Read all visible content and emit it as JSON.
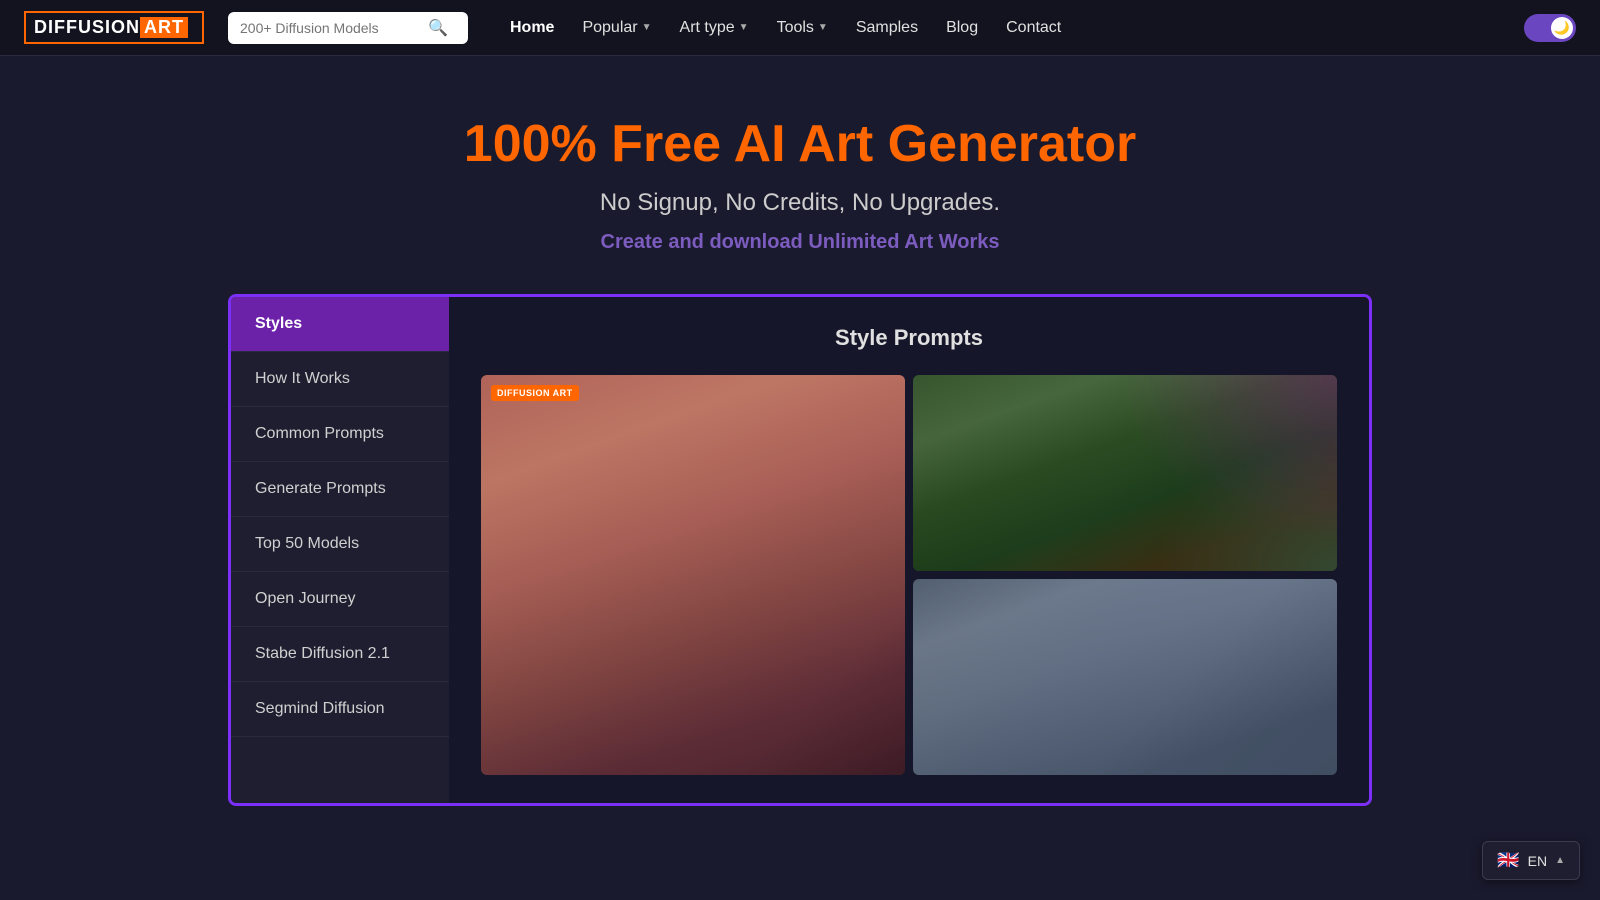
{
  "logo": {
    "diffusion": "DIFFUSION",
    "art": "ART"
  },
  "nav": {
    "search_placeholder": "200+ Diffusion Models",
    "links": [
      {
        "label": "Home",
        "active": true,
        "has_dropdown": false
      },
      {
        "label": "Popular",
        "active": false,
        "has_dropdown": true
      },
      {
        "label": "Art type",
        "active": false,
        "has_dropdown": true
      },
      {
        "label": "Tools",
        "active": false,
        "has_dropdown": true
      },
      {
        "label": "Samples",
        "active": false,
        "has_dropdown": false
      },
      {
        "label": "Blog",
        "active": false,
        "has_dropdown": false
      },
      {
        "label": "Contact",
        "active": false,
        "has_dropdown": false
      }
    ]
  },
  "hero": {
    "title": "100% Free AI Art Generator",
    "subtitle": "No Signup, No Credits, No Upgrades.",
    "cta": "Create and download Unlimited Art Works"
  },
  "sidebar": {
    "items": [
      {
        "label": "Styles",
        "active": true
      },
      {
        "label": "How It Works",
        "active": false
      },
      {
        "label": "Common Prompts",
        "active": false
      },
      {
        "label": "Generate Prompts",
        "active": false
      },
      {
        "label": "Top 50 Models",
        "active": false
      },
      {
        "label": "Open Journey",
        "active": false
      },
      {
        "label": "Stabe Diffusion 2.1",
        "active": false
      },
      {
        "label": "Segmind Diffusion",
        "active": false
      }
    ]
  },
  "content": {
    "title": "Style Prompts"
  },
  "watermark": "DIFFUSION ART",
  "lang": {
    "flag": "🇬🇧",
    "code": "EN",
    "chevron": "▲"
  }
}
